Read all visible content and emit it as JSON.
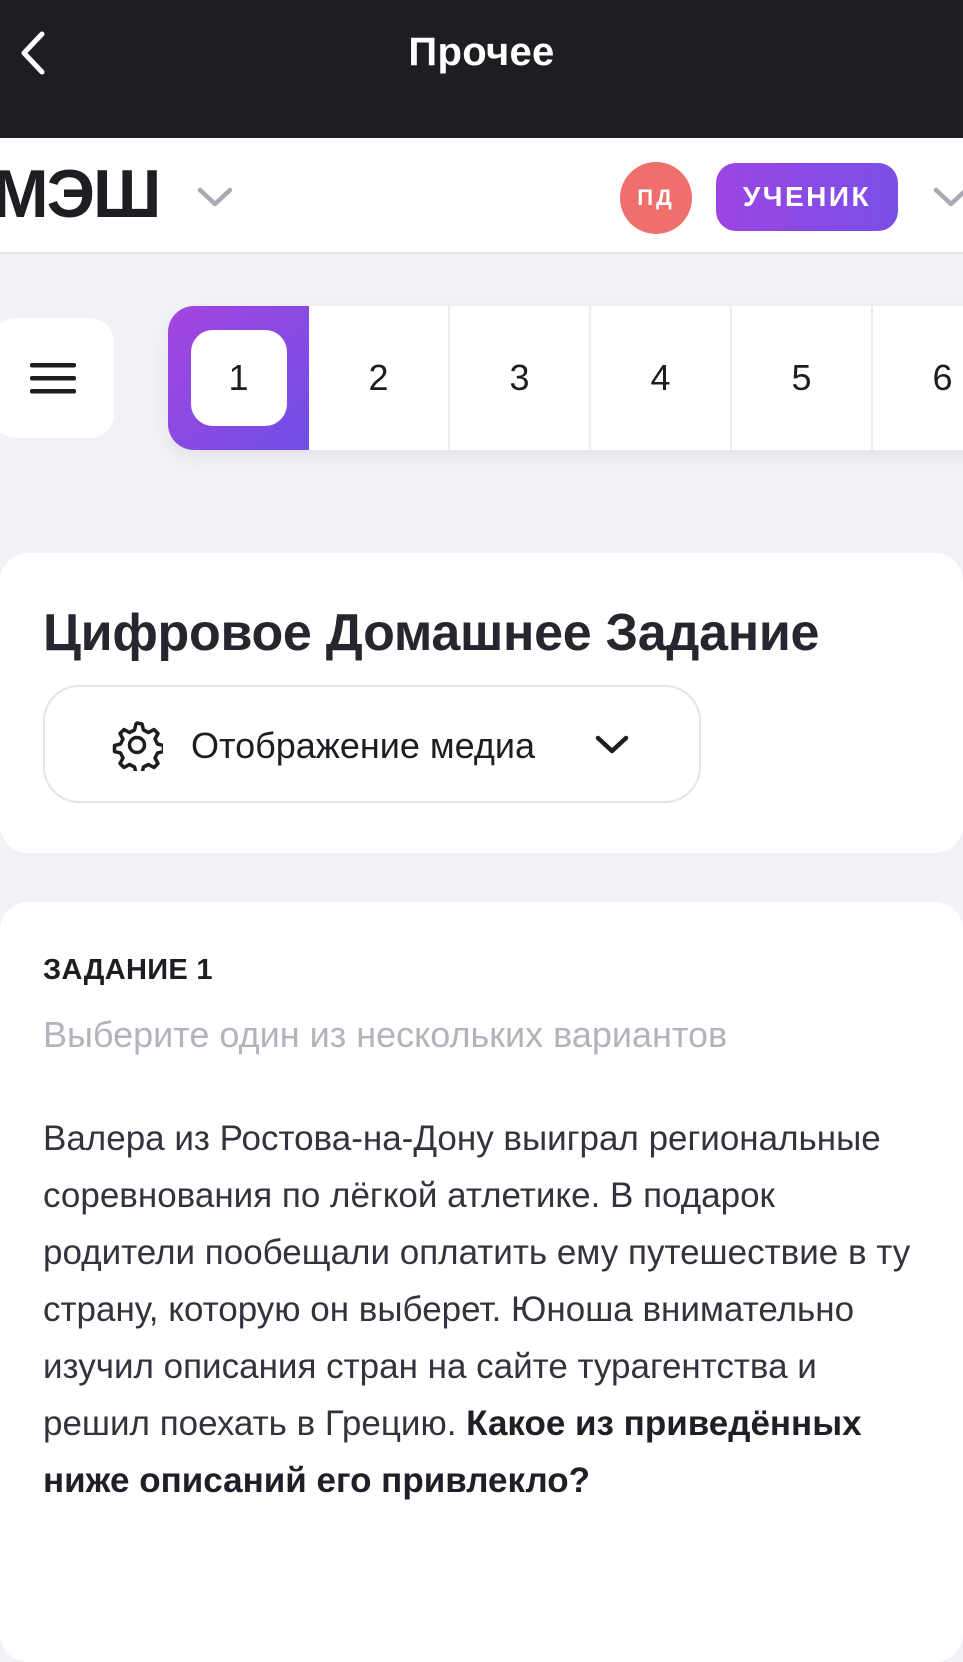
{
  "topbar": {
    "title": "Прочее"
  },
  "header": {
    "logo": "МЭШ",
    "avatar_initials": "ПД",
    "role_label": "УЧЕНИК"
  },
  "task_nav": {
    "tabs": [
      "1",
      "2",
      "3",
      "4",
      "5",
      "6"
    ],
    "active": "1"
  },
  "title_card": {
    "title": "Цифровое Домашнее Задание",
    "media_button_label": "Отображение медиа"
  },
  "task": {
    "label": "ЗАДАНИЕ 1",
    "hint": "Выберите один из нескольких вариантов",
    "text": "Валера из Ростова-на-Дону выиграл региональные соревнования по лёгкой атлетике. В подарок родители пообещали оплатить ему путешествие в ту страну, которую он выберет. Юноша внимательно изучил описания стран на сайте турагентства и решил поехать в Грецию.",
    "question": "Какое из приведённых ниже описаний его привлекло?"
  },
  "colors": {
    "accent": "#8a4ae6",
    "avatar": "#ef6f6c",
    "topbar": "#1e1e22"
  },
  "icons": [
    "back-chevron-icon",
    "chevron-down-icon",
    "hamburger-menu-icon",
    "gear-icon"
  ]
}
